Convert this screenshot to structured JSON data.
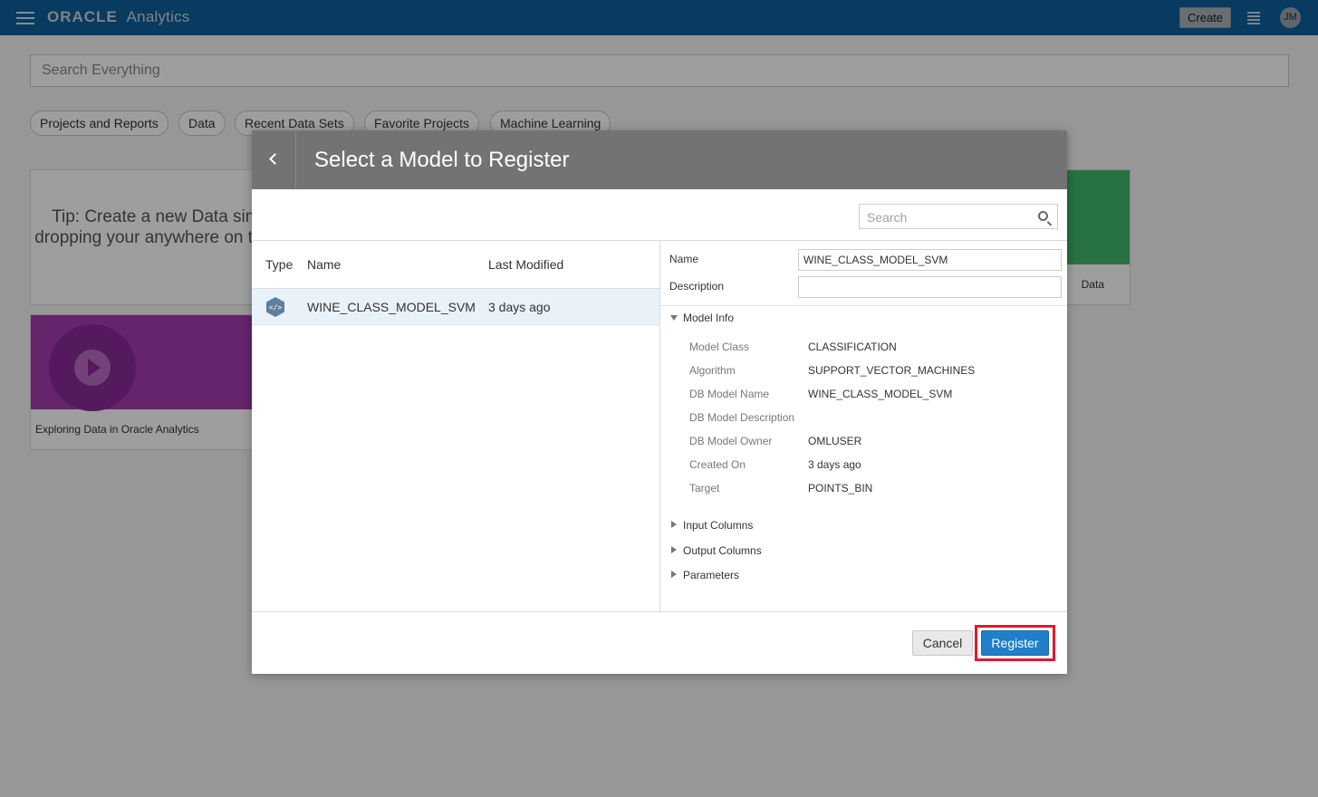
{
  "header": {
    "brand_name": "ORACLE",
    "brand_product": "Analytics",
    "create_label": "Create",
    "user_initials": "JM"
  },
  "page": {
    "search_placeholder": "Search Everything",
    "chips": [
      "Projects and Reports",
      "Data",
      "Recent Data Sets",
      "Favorite Projects",
      "Machine Learning"
    ],
    "tip_text": "Tip: Create a new Data simply dropping your anywhere on this pa",
    "video_card_label": "Exploring Data in Oracle Analytics",
    "green_card_label": "Data"
  },
  "dialog": {
    "title": "Select a Model to Register",
    "search_placeholder": "Search",
    "columns": {
      "type": "Type",
      "name": "Name",
      "last_modified": "Last Modified"
    },
    "row": {
      "name": "WINE_CLASS_MODEL_SVM",
      "last_modified": "3 days ago"
    },
    "details": {
      "name_label": "Name",
      "name_value": "WINE_CLASS_MODEL_SVM",
      "description_label": "Description",
      "description_value": "",
      "model_info_label": "Model Info",
      "info": [
        {
          "k": "Model Class",
          "v": "CLASSIFICATION"
        },
        {
          "k": "Algorithm",
          "v": "SUPPORT_VECTOR_MACHINES"
        },
        {
          "k": "DB Model Name",
          "v": "WINE_CLASS_MODEL_SVM"
        },
        {
          "k": "DB Model Description",
          "v": ""
        },
        {
          "k": "DB Model Owner",
          "v": "OMLUSER"
        },
        {
          "k": "Created On",
          "v": "3 days ago"
        },
        {
          "k": "Target",
          "v": "POINTS_BIN"
        }
      ],
      "sections": [
        "Input Columns",
        "Output Columns",
        "Parameters"
      ]
    },
    "cancel_label": "Cancel",
    "register_label": "Register"
  },
  "colors": {
    "topbar": "#0d5f99",
    "dialog_header": "#737373",
    "primary_button": "#1f7fca",
    "highlight_border": "#e0182f",
    "selected_row": "#e8f2f8"
  }
}
